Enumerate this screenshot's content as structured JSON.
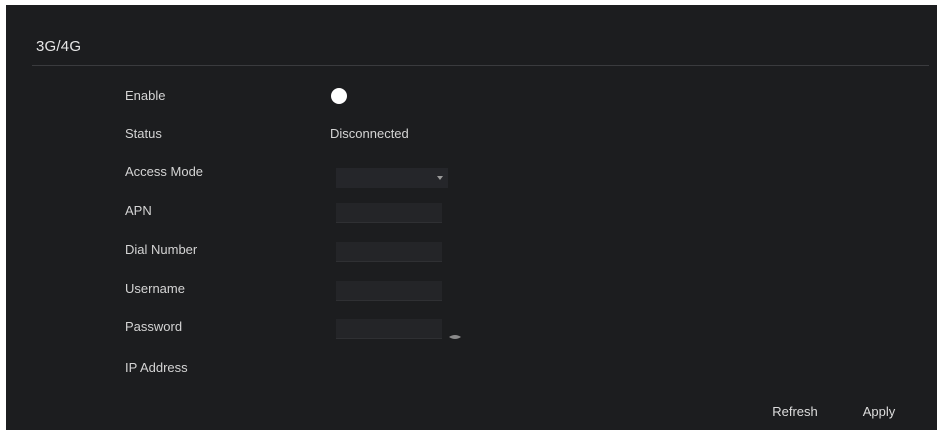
{
  "section": {
    "title": "3G/4G"
  },
  "form": {
    "enable_label": "Enable",
    "enable_on": true,
    "status_label": "Status",
    "status_value": "Disconnected",
    "access_mode_label": "Access Mode",
    "access_mode_value": "",
    "apn_label": "APN",
    "apn_value": "",
    "dial_number_label": "Dial Number",
    "dial_number_value": "",
    "username_label": "Username",
    "username_value": "",
    "password_label": "Password",
    "password_value": "",
    "ip_address_label": "IP Address",
    "ip_address_value": ""
  },
  "actions": {
    "refresh_label": "Refresh",
    "apply_label": "Apply"
  },
  "icons": {
    "caret": "chevron-down-icon",
    "eye": "eye-icon"
  },
  "colors": {
    "panel_bg": "#1c1d1f",
    "text": "#d4d4d4",
    "field_bg": "#242528",
    "toggle_knob": "#ffffff"
  }
}
